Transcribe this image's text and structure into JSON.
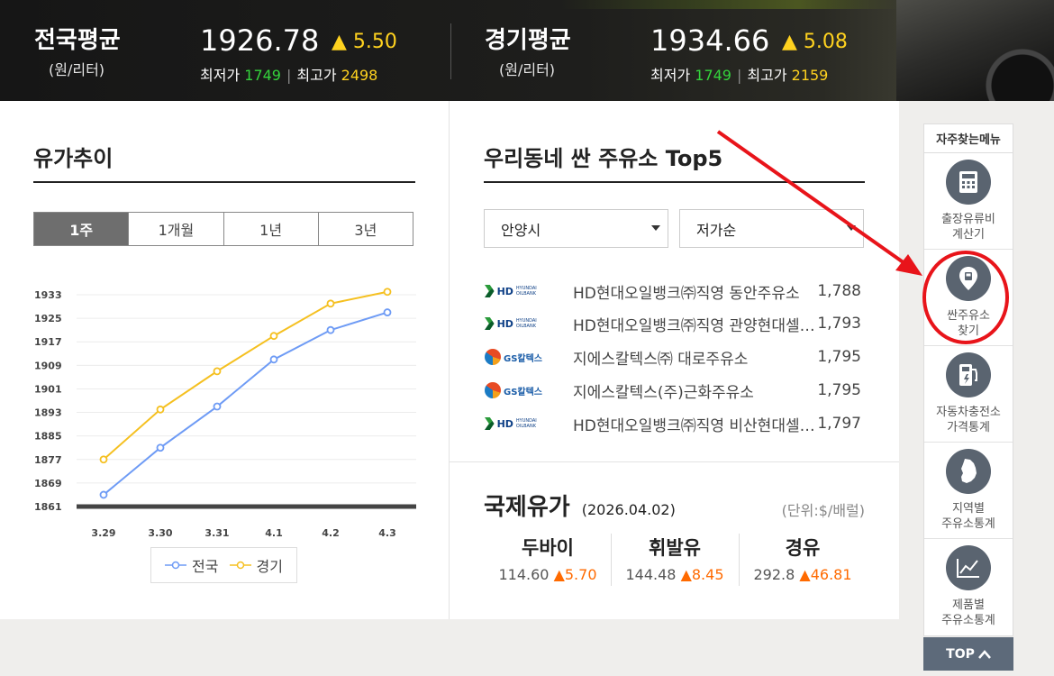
{
  "banner": {
    "national": {
      "name": "전국평균",
      "unit": "(원/리터)",
      "value": "1926.78",
      "change": "5.50",
      "min_label": "최저가",
      "min": "1749",
      "max_label": "최고가",
      "max": "2498"
    },
    "gyeonggi": {
      "name": "경기평균",
      "unit": "(원/리터)",
      "value": "1934.66",
      "change": "5.08",
      "min_label": "최저가",
      "min": "1749",
      "max_label": "최고가",
      "max": "2159"
    }
  },
  "trend": {
    "title": "유가추이",
    "tabs": [
      "1주",
      "1개월",
      "1년",
      "3년"
    ],
    "active_tab": 0
  },
  "chart_data": {
    "type": "line",
    "categories": [
      "3.29",
      "3.30",
      "3.31",
      "4.1",
      "4.2",
      "4.3"
    ],
    "series": [
      {
        "name": "전국",
        "color": "#6e9bf5",
        "values": [
          1865,
          1881,
          1895,
          1911,
          1921,
          1927
        ]
      },
      {
        "name": "경기",
        "color": "#f5c020",
        "values": [
          1877,
          1894,
          1907,
          1919,
          1930,
          1934
        ]
      }
    ],
    "yticks": [
      1861,
      1869,
      1877,
      1885,
      1893,
      1901,
      1909,
      1917,
      1925,
      1933
    ],
    "ylim": [
      1861,
      1933
    ],
    "grid": true,
    "legend": "bottom"
  },
  "top5": {
    "title": "우리동네 싼 주유소 Top5",
    "region": "안양시",
    "sort": "저가순",
    "stations": [
      {
        "brand": "HD",
        "name": "HD현대오일뱅크㈜직영 동안주유소",
        "price": "1,788"
      },
      {
        "brand": "HD",
        "name": "HD현대오일뱅크㈜직영 관양현대셀프주유소",
        "price": "1,793"
      },
      {
        "brand": "GS",
        "name": "지에스칼텍스㈜ 대로주유소",
        "price": "1,795"
      },
      {
        "brand": "GS",
        "name": "지에스칼텍스(주)근화주유소",
        "price": "1,795"
      },
      {
        "brand": "HD",
        "name": "HD현대오일뱅크㈜직영 비산현대셀프주유소",
        "price": "1,797"
      }
    ],
    "logo_hd": "HD",
    "logo_hd_sub": "HYUNDAI OILBANK",
    "logo_gs": "GS칼텍스"
  },
  "oil": {
    "title": "국제유가",
    "date": "(2026.04.02)",
    "unit": "(단위:$/배럴)",
    "items": [
      {
        "name": "두바이",
        "price": "114.60",
        "change": "5.70"
      },
      {
        "name": "휘발유",
        "price": "144.48",
        "change": "8.45"
      },
      {
        "name": "경유",
        "price": "292.8",
        "change": "46.81"
      }
    ]
  },
  "quick_menu": {
    "title": "자주찾는메뉴",
    "items": [
      {
        "icon": "calculator-icon",
        "label1": "출장유류비",
        "label2": "계산기"
      },
      {
        "icon": "location-pin-icon",
        "label1": "싼주유소",
        "label2": "찾기"
      },
      {
        "icon": "ev-charger-icon",
        "label1": "자동차충전소",
        "label2": "가격통계"
      },
      {
        "icon": "korea-map-icon",
        "label1": "지역별",
        "label2": "주유소통계"
      },
      {
        "icon": "line-chart-icon",
        "label1": "제품별",
        "label2": "주유소통계"
      }
    ],
    "top_label": "TOP"
  },
  "colors": {
    "annotation_red": "#e8141a",
    "up_triangle": "#ffd21f",
    "oil_up": "#ff6a00"
  }
}
